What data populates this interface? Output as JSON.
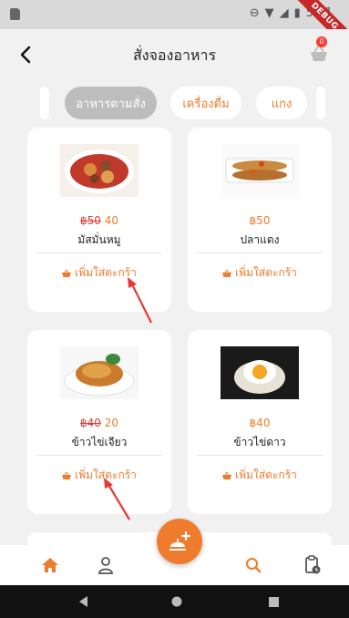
{
  "status_bar": {
    "time": "5:41",
    "debug_label": "DEBUG",
    "badge_count": "0"
  },
  "app_bar": {
    "title": "สั่งจองอาหาร",
    "cart_badge": "0"
  },
  "categories": [
    {
      "label": "อาหารตามสั่ง",
      "active": true
    },
    {
      "label": "เครื่องดื่ม",
      "active": false
    },
    {
      "label": "แกง",
      "active": false
    }
  ],
  "products": [
    {
      "name": "มัสมั่นหมู",
      "old_price": "฿50",
      "price": "40",
      "add_label": "เพิ่มใส่ตะกร้า"
    },
    {
      "name": "ปลาแดง",
      "old_price": "",
      "price": "฿50",
      "add_label": "เพิ่มใส่ตะกร้า"
    },
    {
      "name": "ข้าวไข่เจียว",
      "old_price": "฿40",
      "price": "20",
      "add_label": "เพิ่มใส่ตะกร้า"
    },
    {
      "name": "ข้าวไข่ดาว",
      "old_price": "",
      "price": "฿40",
      "add_label": "เพิ่มใส่ตะกร้า"
    }
  ],
  "colors": {
    "accent": "#ef7b2d",
    "discount": "#e53935",
    "background": "#f1f1f1"
  },
  "bottom_nav": [
    {
      "icon": "home-icon",
      "active": true
    },
    {
      "icon": "profile-icon",
      "active": false
    },
    {
      "icon": "add-order-icon",
      "active": false
    },
    {
      "icon": "search-icon",
      "active": false
    },
    {
      "icon": "order-history-icon",
      "active": false
    }
  ]
}
